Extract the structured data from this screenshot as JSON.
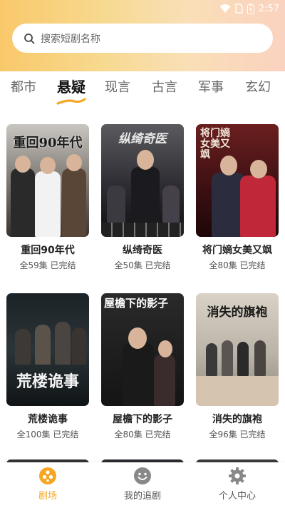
{
  "status_bar": {
    "time": "2:57"
  },
  "search": {
    "placeholder": "搜索短剧名称"
  },
  "tabs": [
    {
      "label": "都市"
    },
    {
      "label": "悬疑"
    },
    {
      "label": "现言"
    },
    {
      "label": "古言"
    },
    {
      "label": "军事"
    },
    {
      "label": "玄幻"
    }
  ],
  "active_tab": "悬疑",
  "dramas": [
    {
      "title": "重回90年代",
      "poster_text": "重回90年代",
      "episodes": "全59集",
      "status": "已完结"
    },
    {
      "title": "纵绮奇医",
      "poster_text": "纵绮奇医",
      "episodes": "全50集",
      "status": "已完结"
    },
    {
      "title": "将门嫡女美又飒",
      "poster_text": "将门嫡女美又飒",
      "episodes": "全80集",
      "status": "已完结"
    },
    {
      "title": "荒楼诡事",
      "poster_text": "荒楼诡事",
      "episodes": "全100集",
      "status": "已完结"
    },
    {
      "title": "屋檐下的影子",
      "poster_text": "屋檐下的影子",
      "episodes": "全80集",
      "status": "已完结"
    },
    {
      "title": "消失的旗袍",
      "poster_text": "消失的旗袍",
      "episodes": "全96集",
      "status": "已完结"
    }
  ],
  "bottom_nav": [
    {
      "label": "剧场",
      "icon": "theater-icon",
      "active": true
    },
    {
      "label": "我的追剧",
      "icon": "smile-icon",
      "active": false
    },
    {
      "label": "个人中心",
      "icon": "gear-icon",
      "active": false
    }
  ],
  "colors": {
    "accent": "#f5a623",
    "header_left": "#f9c86a",
    "header_right": "#fbd2c0"
  }
}
